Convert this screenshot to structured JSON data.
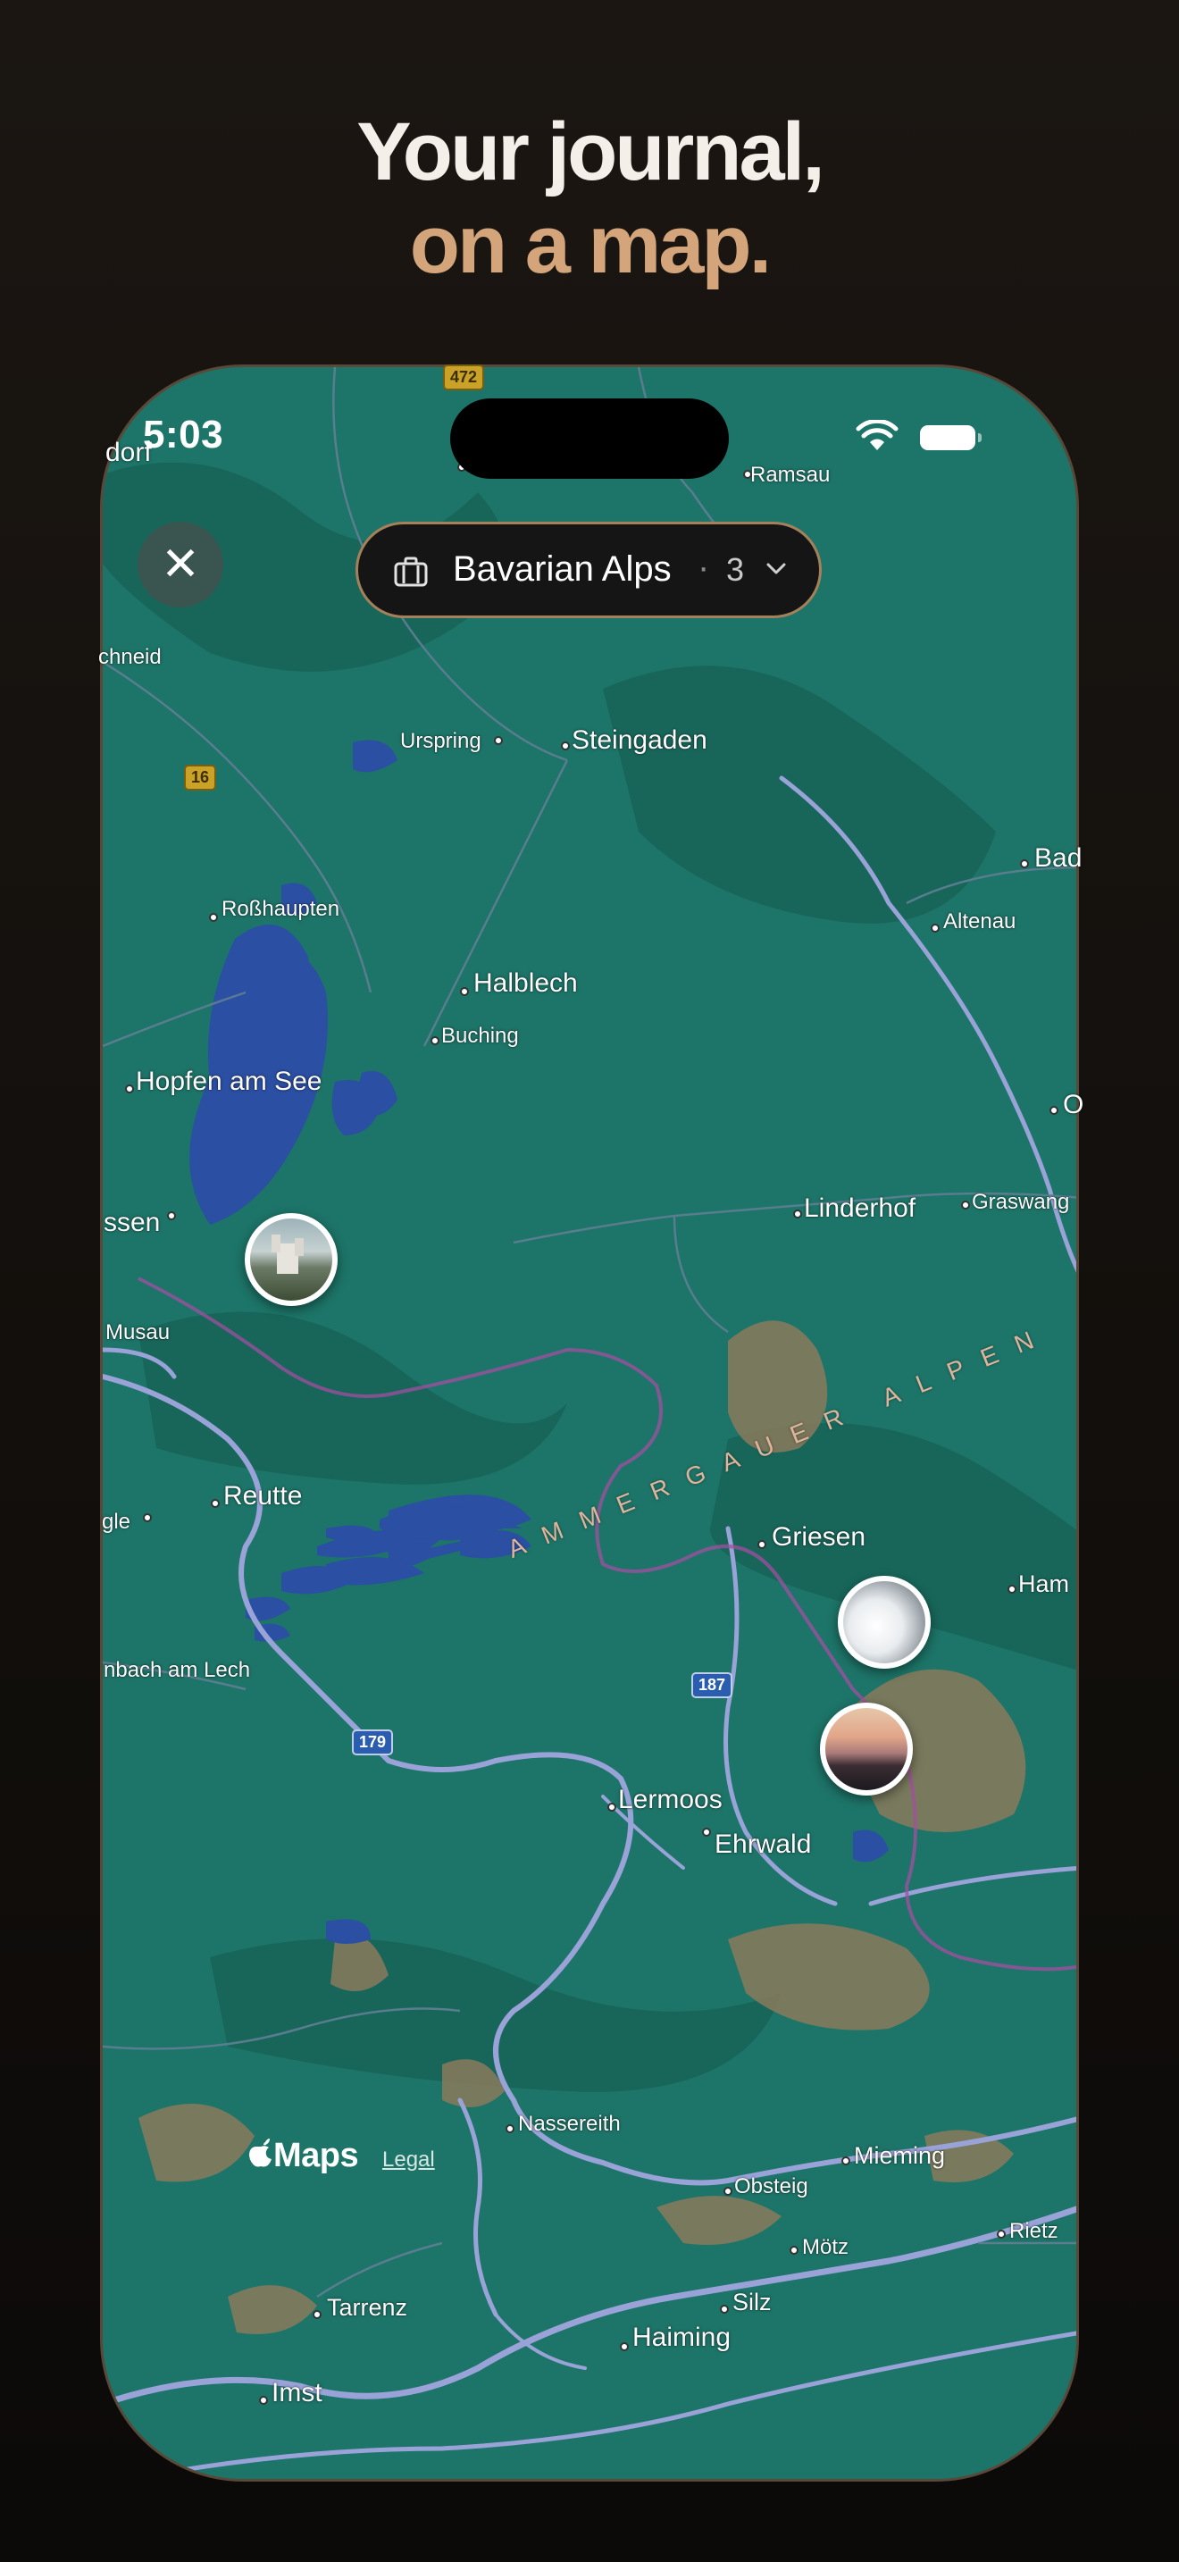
{
  "headline": {
    "line1": "Your journal,",
    "line2": "on a map."
  },
  "status_bar": {
    "time": "5:03"
  },
  "trip_selector": {
    "name": "Bavarian Alps",
    "separator": "·",
    "count": "3"
  },
  "map_attribution": {
    "brand": "Maps",
    "legal": "Legal"
  },
  "mountain_range": "AMMERGAUER ALPEN",
  "road_shields": [
    "472",
    "16",
    "187",
    "179"
  ],
  "places": [
    "dorf",
    "Ramsau",
    "chneid",
    "Urspring",
    "Steingaden",
    "Bad",
    "Roßhaupten",
    "Altenau",
    "Halblech",
    "Buching",
    "Hopfen am See",
    "O",
    "ssen",
    "Linderhof",
    "Graswang",
    "Musau",
    "Reutte",
    "gle",
    "Griesen",
    "Ham",
    "nbach am Lech",
    "Lermoos",
    "Ehrwald",
    "Nassereith",
    "Mieming",
    "Obsteig",
    "Mötz",
    "Rietz",
    "Tarrenz",
    "Silz",
    "Haiming",
    "Imst"
  ],
  "photo_pins": [
    "castle-photo",
    "snowy-peak-photo",
    "sunset-photo"
  ],
  "colors": {
    "accent": "#d4a57a",
    "map_base": "#1d7468",
    "water": "#2b4fa3",
    "pill_border": "#a5815b"
  }
}
